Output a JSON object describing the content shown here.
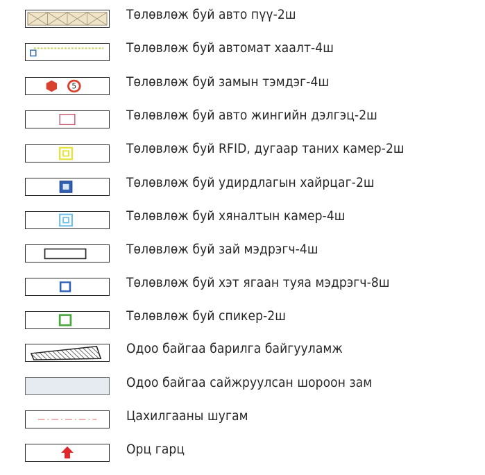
{
  "legend": {
    "items": [
      {
        "icon": "planned-parking-icon",
        "label": "Төлөвлөж буй авто пүү-2ш"
      },
      {
        "icon": "automatic-barrier-icon",
        "label": "Төлөвлөж буй автомат хаалт-4ш"
      },
      {
        "icon": "road-sign-icon",
        "label": "Төлөвлөж буй замын тэмдэг-4ш",
        "sign_text": "5"
      },
      {
        "icon": "traffic-display-icon",
        "label": "Төлөвлөж буй авто жингийн дэлгэц-2ш"
      },
      {
        "icon": "rfid-camera-icon",
        "label": "Төлөвлөж буй RFID, дугаар таних камер-2ш"
      },
      {
        "icon": "control-box-icon",
        "label": "Төлөвлөж буй удирдлагын хайрцаг-2ш"
      },
      {
        "icon": "surveillance-camera-icon",
        "label": "Төлөвлөж буй хяналтын камер-4ш"
      },
      {
        "icon": "load-sensor-icon",
        "label": "Төлөвлөж буй зай мэдрэгч-4ш"
      },
      {
        "icon": "infrared-sensor-icon",
        "label": "Төлөвлөж буй хэт ягаан туяа мэдрэгч-8ш"
      },
      {
        "icon": "speaker-icon",
        "label": "Төлөвлөж буй спикер-2ш"
      },
      {
        "icon": "existing-building-icon",
        "label": "Одоо байгаа барилга байгууламж"
      },
      {
        "icon": "gravel-road-icon",
        "label": "Одоо байгаа сайжруулсан шороон зам"
      },
      {
        "icon": "power-line-icon",
        "label": "Цахилгааны шугам"
      },
      {
        "icon": "entry-exit-arrow-icon",
        "label": "Орц гарц"
      }
    ],
    "colors": {
      "outline": "#2a2a2a",
      "text": "#262626",
      "parking_fill": "#efe3c8",
      "barrier_line": "#c9d36a",
      "barrier_box": "#3c6fb0",
      "sign_red": "#d8412e",
      "display_pink": "#c9546b",
      "rfid_yellow": "#e6e33a",
      "control_blue": "#2f5fb0",
      "camera_cyan": "#6fc0e8",
      "ir_blue": "#2b5fb8",
      "speaker_green": "#48a93c",
      "road_fill": "#e6ebf2",
      "power_red": "#d96a6a",
      "arrow_red": "#e0282a"
    }
  }
}
